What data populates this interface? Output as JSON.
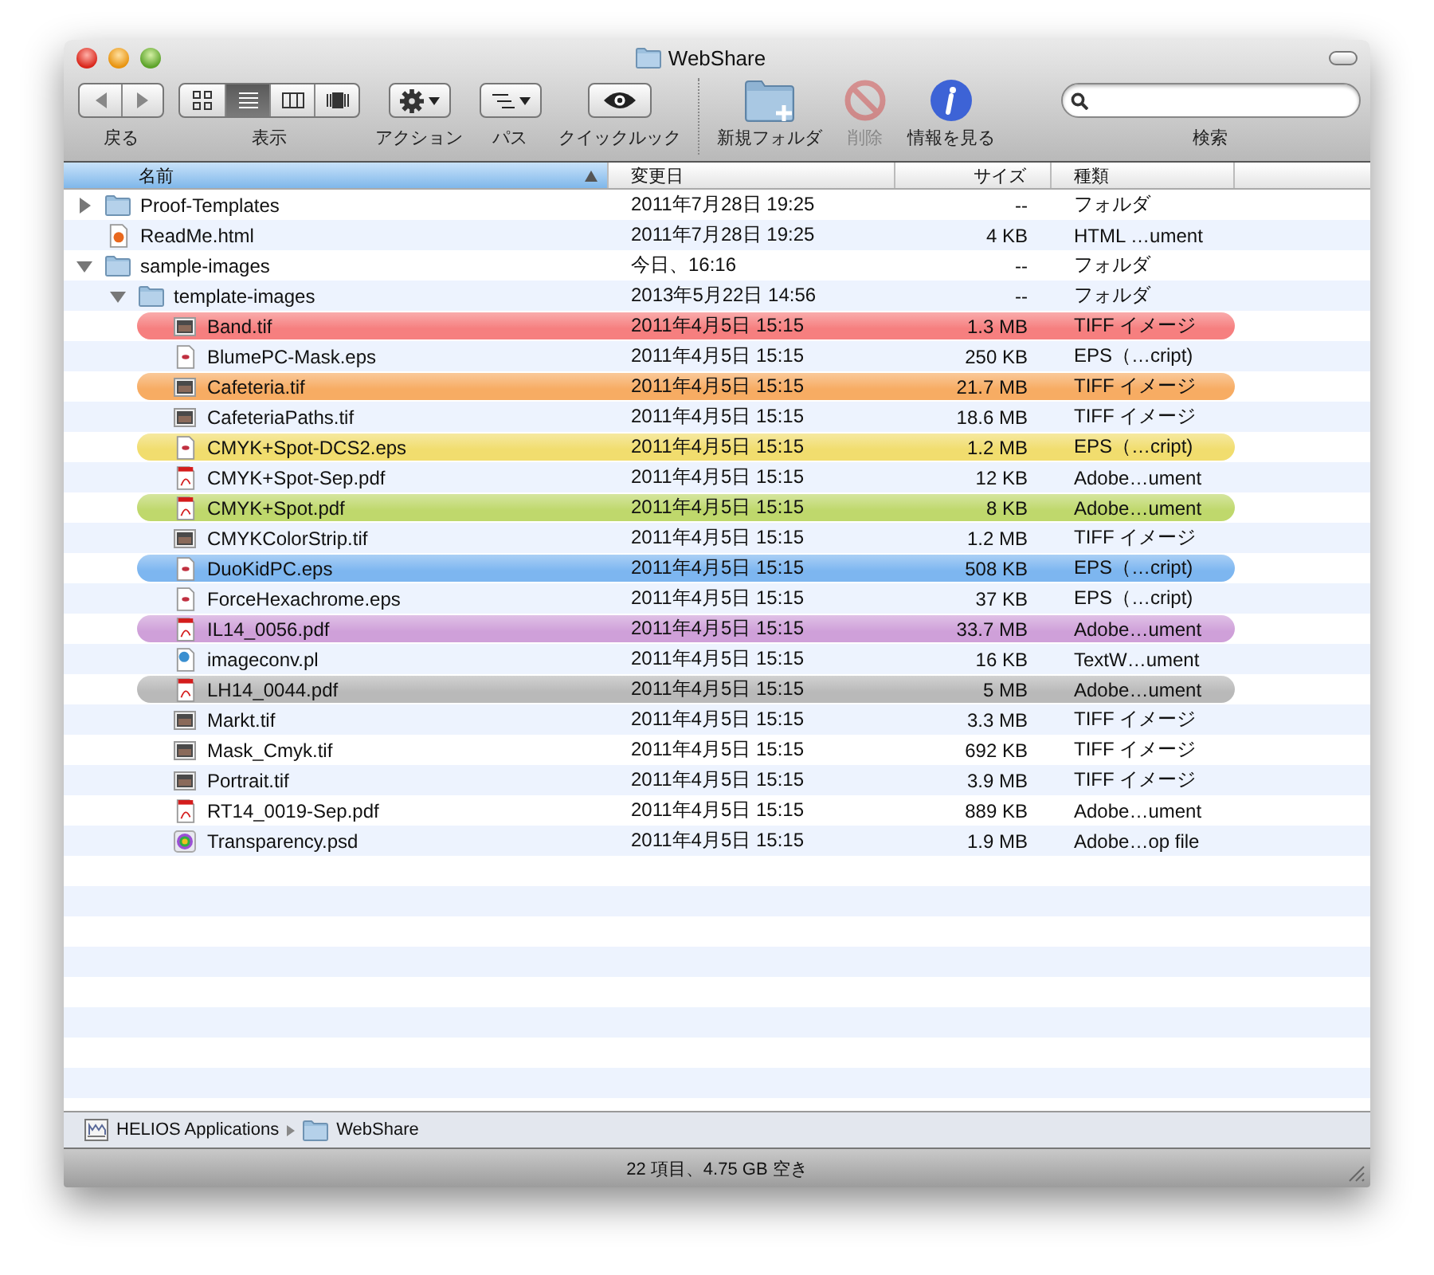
{
  "window": {
    "title": "WebShare"
  },
  "toolbar": [
    {
      "kind": "nav",
      "label": "戻る"
    },
    {
      "kind": "view",
      "label": "表示",
      "modes": [
        {
          "kind": "icons",
          "selected": false
        },
        {
          "kind": "list",
          "selected": true
        },
        {
          "kind": "columns",
          "selected": false
        },
        {
          "kind": "coverflow",
          "selected": false
        }
      ]
    },
    {
      "kind": "action",
      "label": "アクション"
    },
    {
      "kind": "path",
      "label": "パス"
    },
    {
      "kind": "quicklook",
      "label": "クイックルック"
    },
    {
      "kind": "separator"
    },
    {
      "kind": "new_folder",
      "label": "新規フォルダ",
      "disabled": false
    },
    {
      "kind": "delete",
      "label": "削除",
      "disabled": true
    },
    {
      "kind": "info",
      "label": "情報を見る",
      "disabled": false
    },
    {
      "kind": "search",
      "label": "検索"
    }
  ],
  "columns": [
    {
      "label": "名前",
      "sorted": true
    },
    {
      "label": "変更日",
      "sorted": false
    },
    {
      "label": "サイズ",
      "sorted": false
    },
    {
      "label": "種類",
      "sorted": false
    }
  ],
  "rows": [
    {
      "name": "Proof-Templates",
      "modified": "2011年7月28日 19:25",
      "size": "--",
      "type": "フォルダ",
      "kind": "folder",
      "expanded": false
    },
    {
      "name": "ReadMe.html",
      "modified": "2011年7月28日 19:25",
      "size": "4 KB",
      "type": "HTML …ument",
      "kind": "html"
    },
    {
      "name": "sample-images",
      "modified": "今日、16:16",
      "size": "--",
      "type": "フォルダ",
      "kind": "folder",
      "expanded": true,
      "children": [
        {
          "name": "template-images",
          "modified": "2013年5月22日 14:56",
          "size": "--",
          "type": "フォルダ",
          "kind": "folder",
          "expanded": true,
          "children": [
            {
              "name": "Band.tif",
              "modified": "2011年4月5日 15:15",
              "size": "1.3 MB",
              "type": "TIFF イメージ",
              "kind": "tif",
              "color": "#f67f7f"
            },
            {
              "name": "BlumePC-Mask.eps",
              "modified": "2011年4月5日 15:15",
              "size": "250 KB",
              "type": "EPS（…cript)",
              "kind": "eps"
            },
            {
              "name": "Cafeteria.tif",
              "modified": "2011年4月5日 15:15",
              "size": "21.7 MB",
              "type": "TIFF イメージ",
              "kind": "tif",
              "color": "#f7ac63"
            },
            {
              "name": "CafeteriaPaths.tif",
              "modified": "2011年4月5日 15:15",
              "size": "18.6 MB",
              "type": "TIFF イメージ",
              "kind": "tif"
            },
            {
              "name": "CMYK+Spot-DCS2.eps",
              "modified": "2011年4月5日 15:15",
              "size": "1.2 MB",
              "type": "EPS（…cript)",
              "kind": "eps",
              "color": "#f1dd6e"
            },
            {
              "name": "CMYK+Spot-Sep.pdf",
              "modified": "2011年4月5日 15:15",
              "size": "12 KB",
              "type": "Adobe…ument",
              "kind": "pdf"
            },
            {
              "name": "CMYK+Spot.pdf",
              "modified": "2011年4月5日 15:15",
              "size": "8 KB",
              "type": "Adobe…ument",
              "kind": "pdf",
              "color": "#bfd86c"
            },
            {
              "name": "CMYKColorStrip.tif",
              "modified": "2011年4月5日 15:15",
              "size": "1.2 MB",
              "type": "TIFF イメージ",
              "kind": "tif"
            },
            {
              "name": "DuoKidPC.eps",
              "modified": "2011年4月5日 15:15",
              "size": "508 KB",
              "type": "EPS（…cript)",
              "kind": "eps",
              "color": "#7db6f0"
            },
            {
              "name": "ForceHexachrome.eps",
              "modified": "2011年4月5日 15:15",
              "size": "37 KB",
              "type": "EPS（…cript)",
              "kind": "eps"
            },
            {
              "name": "IL14_0056.pdf",
              "modified": "2011年4月5日 15:15",
              "size": "33.7 MB",
              "type": "Adobe…ument",
              "kind": "pdf",
              "color": "#cfa0d9"
            },
            {
              "name": "imageconv.pl",
              "modified": "2011年4月5日 15:15",
              "size": "16 KB",
              "type": "TextW…ument",
              "kind": "pl"
            },
            {
              "name": "LH14_0044.pdf",
              "modified": "2011年4月5日 15:15",
              "size": "5 MB",
              "type": "Adobe…ument",
              "kind": "pdf",
              "color": "#b9b9b9"
            },
            {
              "name": "Markt.tif",
              "modified": "2011年4月5日 15:15",
              "size": "3.3 MB",
              "type": "TIFF イメージ",
              "kind": "tif"
            },
            {
              "name": "Mask_Cmyk.tif",
              "modified": "2011年4月5日 15:15",
              "size": "692 KB",
              "type": "TIFF イメージ",
              "kind": "tif"
            },
            {
              "name": "Portrait.tif",
              "modified": "2011年4月5日 15:15",
              "size": "3.9 MB",
              "type": "TIFF イメージ",
              "kind": "tif"
            },
            {
              "name": "RT14_0019-Sep.pdf",
              "modified": "2011年4月5日 15:15",
              "size": "889 KB",
              "type": "Adobe…ument",
              "kind": "pdf"
            },
            {
              "name": "Transparency.psd",
              "modified": "2011年4月5日 15:15",
              "size": "1.9 MB",
              "type": "Adobe…op file",
              "kind": "psd"
            }
          ]
        }
      ]
    }
  ],
  "path_bar": [
    {
      "kind": "app",
      "label": "HELIOS Applications"
    },
    {
      "kind": "folder",
      "label": "WebShare"
    }
  ],
  "status_bar": "22 項目、4.75 GB 空き"
}
